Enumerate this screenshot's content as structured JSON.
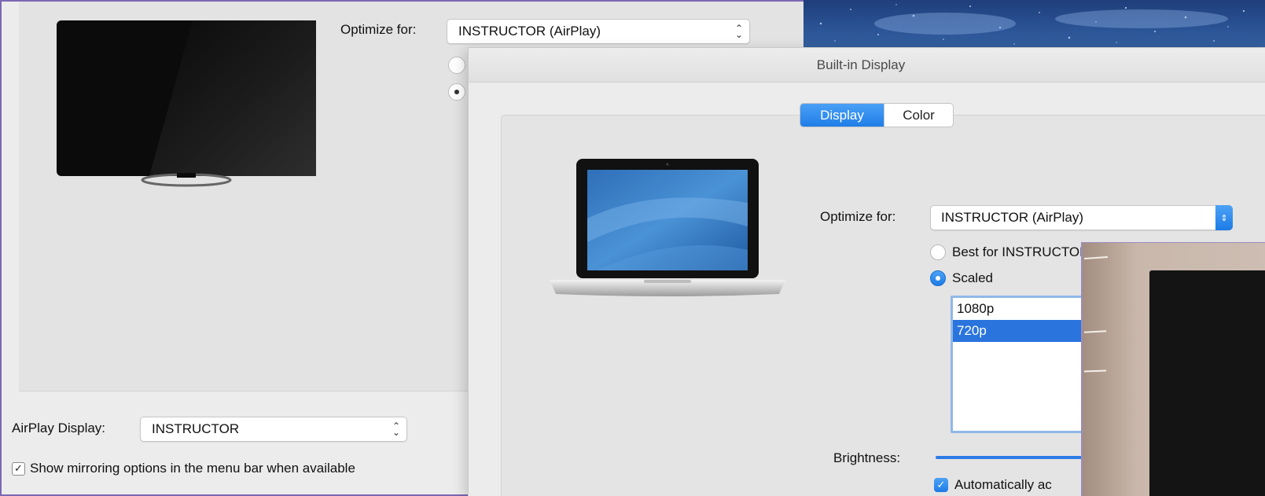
{
  "back_window": {
    "optimize_label": "Optimize for:",
    "optimize_value": "INSTRUCTOR (AirPlay)",
    "airplay_label": "AirPlay Display:",
    "airplay_value": "INSTRUCTOR",
    "mirror_checkbox_label": "Show mirroring options in the menu bar when available",
    "mirror_checked": true
  },
  "front_window": {
    "title": "Built-in Display",
    "tabs": [
      {
        "label": "Display",
        "active": true
      },
      {
        "label": "Color",
        "active": false
      }
    ],
    "optimize_label": "Optimize for:",
    "optimize_value": "INSTRUCTOR (AirPlay)",
    "radios": [
      {
        "label": "Best for INSTRUCTOR",
        "selected": false
      },
      {
        "label": "Scaled",
        "selected": true
      }
    ],
    "resolutions": [
      {
        "label": "1080p",
        "selected": false
      },
      {
        "label": "720p",
        "selected": true
      }
    ],
    "brightness_label": "Brightness:",
    "auto_brightness_label": "Automatically ac",
    "auto_brightness_checked": true
  },
  "colors": {
    "accent": "#1f7ee8",
    "selection": "#2a74dd",
    "window_border": "#7b68b3"
  }
}
